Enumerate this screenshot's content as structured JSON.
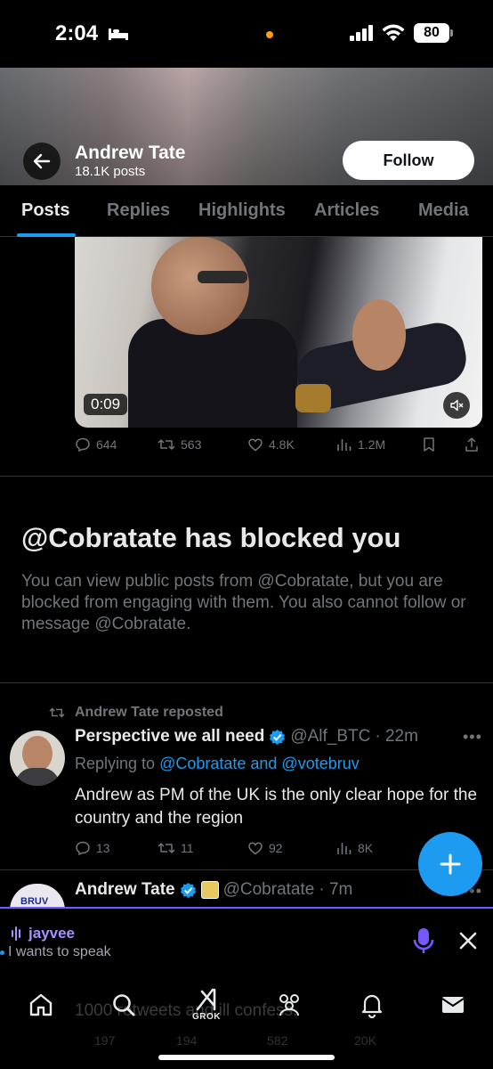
{
  "status_bar": {
    "time": "2:04",
    "battery": "80"
  },
  "profile": {
    "name": "Andrew Tate",
    "post_count": "18.1K posts",
    "follow_label": "Follow"
  },
  "tabs": [
    {
      "label": "Posts",
      "active": true
    },
    {
      "label": "Replies",
      "active": false
    },
    {
      "label": "Highlights",
      "active": false
    },
    {
      "label": "Articles",
      "active": false
    },
    {
      "label": "Media",
      "active": false
    }
  ],
  "video_post": {
    "duration": "0:09",
    "actions": {
      "replies": "644",
      "reposts": "563",
      "likes": "4.8K",
      "views": "1.2M"
    }
  },
  "blocked": {
    "title": "@Cobratate has blocked you",
    "text": "You can view public posts from @Cobratate, but you are blocked from engaging with them. You also cannot follow or message @Cobratate."
  },
  "repost": {
    "label": "Andrew Tate reposted",
    "author_name": "Perspective we all need",
    "author_handle": "@Alf_BTC",
    "time": "· 22m",
    "replying_prefix": "Replying to",
    "replying_to": "@Cobratate and @votebruv",
    "text": "Andrew as PM of the UK is the only clear hope for the country and the region",
    "actions": {
      "replies": "13",
      "reposts": "11",
      "likes": "92",
      "views": "8K"
    }
  },
  "next_post": {
    "author_name": "Andrew Tate",
    "author_handle": "@Cobratate",
    "time": "· 7m",
    "avatar_text": "BRUV",
    "text_partial": "1000 retweets and ill confess.",
    "actions": {
      "replies": "197",
      "reposts": "194",
      "likes": "582",
      "views": "20K"
    }
  },
  "spaces": {
    "user": "jayvee",
    "status": "I wants to speak"
  },
  "nav": {
    "grok_label": "GROK"
  },
  "colors": {
    "accent": "#1d9bf0",
    "spaces_purple": "#7856ff",
    "muted": "#71767b"
  },
  "icons": [
    "back-arrow-icon",
    "mute-icon",
    "reply-icon",
    "repost-icon",
    "like-icon",
    "views-icon",
    "bookmark-icon",
    "share-icon",
    "verified-icon",
    "more-icon",
    "plus-icon",
    "mic-icon",
    "close-icon",
    "home-icon",
    "search-icon",
    "grok-icon",
    "communities-icon",
    "notifications-icon",
    "messages-icon"
  ]
}
